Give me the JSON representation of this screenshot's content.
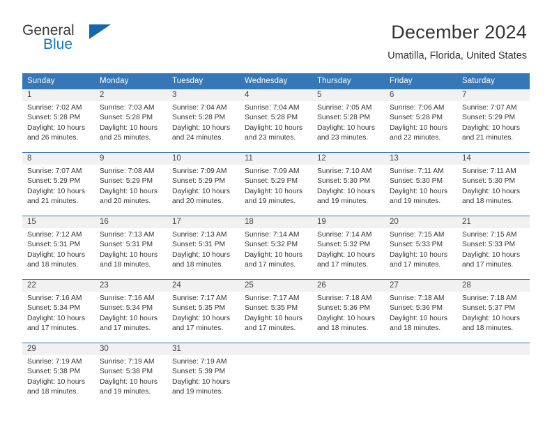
{
  "brand": {
    "name_line1": "General",
    "name_line2": "Blue",
    "triangle_icon": "triangle-icon"
  },
  "header": {
    "title": "December 2024",
    "subtitle": "Umatilla, Florida, United States"
  },
  "colors": {
    "header_blue": "#3577b7",
    "daynum_band": "#f1f1f1",
    "brand_blue": "#1278be",
    "text": "#333333"
  },
  "weekday_headers": [
    "Sunday",
    "Monday",
    "Tuesday",
    "Wednesday",
    "Thursday",
    "Friday",
    "Saturday"
  ],
  "weeks": [
    {
      "days": [
        {
          "num": "1",
          "sunrise": "Sunrise: 7:02 AM",
          "sunset": "Sunset: 5:28 PM",
          "daylight1": "Daylight: 10 hours",
          "daylight2": "and 26 minutes."
        },
        {
          "num": "2",
          "sunrise": "Sunrise: 7:03 AM",
          "sunset": "Sunset: 5:28 PM",
          "daylight1": "Daylight: 10 hours",
          "daylight2": "and 25 minutes."
        },
        {
          "num": "3",
          "sunrise": "Sunrise: 7:04 AM",
          "sunset": "Sunset: 5:28 PM",
          "daylight1": "Daylight: 10 hours",
          "daylight2": "and 24 minutes."
        },
        {
          "num": "4",
          "sunrise": "Sunrise: 7:04 AM",
          "sunset": "Sunset: 5:28 PM",
          "daylight1": "Daylight: 10 hours",
          "daylight2": "and 23 minutes."
        },
        {
          "num": "5",
          "sunrise": "Sunrise: 7:05 AM",
          "sunset": "Sunset: 5:28 PM",
          "daylight1": "Daylight: 10 hours",
          "daylight2": "and 23 minutes."
        },
        {
          "num": "6",
          "sunrise": "Sunrise: 7:06 AM",
          "sunset": "Sunset: 5:28 PM",
          "daylight1": "Daylight: 10 hours",
          "daylight2": "and 22 minutes."
        },
        {
          "num": "7",
          "sunrise": "Sunrise: 7:07 AM",
          "sunset": "Sunset: 5:29 PM",
          "daylight1": "Daylight: 10 hours",
          "daylight2": "and 21 minutes."
        }
      ]
    },
    {
      "days": [
        {
          "num": "8",
          "sunrise": "Sunrise: 7:07 AM",
          "sunset": "Sunset: 5:29 PM",
          "daylight1": "Daylight: 10 hours",
          "daylight2": "and 21 minutes."
        },
        {
          "num": "9",
          "sunrise": "Sunrise: 7:08 AM",
          "sunset": "Sunset: 5:29 PM",
          "daylight1": "Daylight: 10 hours",
          "daylight2": "and 20 minutes."
        },
        {
          "num": "10",
          "sunrise": "Sunrise: 7:09 AM",
          "sunset": "Sunset: 5:29 PM",
          "daylight1": "Daylight: 10 hours",
          "daylight2": "and 20 minutes."
        },
        {
          "num": "11",
          "sunrise": "Sunrise: 7:09 AM",
          "sunset": "Sunset: 5:29 PM",
          "daylight1": "Daylight: 10 hours",
          "daylight2": "and 19 minutes."
        },
        {
          "num": "12",
          "sunrise": "Sunrise: 7:10 AM",
          "sunset": "Sunset: 5:30 PM",
          "daylight1": "Daylight: 10 hours",
          "daylight2": "and 19 minutes."
        },
        {
          "num": "13",
          "sunrise": "Sunrise: 7:11 AM",
          "sunset": "Sunset: 5:30 PM",
          "daylight1": "Daylight: 10 hours",
          "daylight2": "and 19 minutes."
        },
        {
          "num": "14",
          "sunrise": "Sunrise: 7:11 AM",
          "sunset": "Sunset: 5:30 PM",
          "daylight1": "Daylight: 10 hours",
          "daylight2": "and 18 minutes."
        }
      ]
    },
    {
      "days": [
        {
          "num": "15",
          "sunrise": "Sunrise: 7:12 AM",
          "sunset": "Sunset: 5:31 PM",
          "daylight1": "Daylight: 10 hours",
          "daylight2": "and 18 minutes."
        },
        {
          "num": "16",
          "sunrise": "Sunrise: 7:13 AM",
          "sunset": "Sunset: 5:31 PM",
          "daylight1": "Daylight: 10 hours",
          "daylight2": "and 18 minutes."
        },
        {
          "num": "17",
          "sunrise": "Sunrise: 7:13 AM",
          "sunset": "Sunset: 5:31 PM",
          "daylight1": "Daylight: 10 hours",
          "daylight2": "and 18 minutes."
        },
        {
          "num": "18",
          "sunrise": "Sunrise: 7:14 AM",
          "sunset": "Sunset: 5:32 PM",
          "daylight1": "Daylight: 10 hours",
          "daylight2": "and 17 minutes."
        },
        {
          "num": "19",
          "sunrise": "Sunrise: 7:14 AM",
          "sunset": "Sunset: 5:32 PM",
          "daylight1": "Daylight: 10 hours",
          "daylight2": "and 17 minutes."
        },
        {
          "num": "20",
          "sunrise": "Sunrise: 7:15 AM",
          "sunset": "Sunset: 5:33 PM",
          "daylight1": "Daylight: 10 hours",
          "daylight2": "and 17 minutes."
        },
        {
          "num": "21",
          "sunrise": "Sunrise: 7:15 AM",
          "sunset": "Sunset: 5:33 PM",
          "daylight1": "Daylight: 10 hours",
          "daylight2": "and 17 minutes."
        }
      ]
    },
    {
      "days": [
        {
          "num": "22",
          "sunrise": "Sunrise: 7:16 AM",
          "sunset": "Sunset: 5:34 PM",
          "daylight1": "Daylight: 10 hours",
          "daylight2": "and 17 minutes."
        },
        {
          "num": "23",
          "sunrise": "Sunrise: 7:16 AM",
          "sunset": "Sunset: 5:34 PM",
          "daylight1": "Daylight: 10 hours",
          "daylight2": "and 17 minutes."
        },
        {
          "num": "24",
          "sunrise": "Sunrise: 7:17 AM",
          "sunset": "Sunset: 5:35 PM",
          "daylight1": "Daylight: 10 hours",
          "daylight2": "and 17 minutes."
        },
        {
          "num": "25",
          "sunrise": "Sunrise: 7:17 AM",
          "sunset": "Sunset: 5:35 PM",
          "daylight1": "Daylight: 10 hours",
          "daylight2": "and 17 minutes."
        },
        {
          "num": "26",
          "sunrise": "Sunrise: 7:18 AM",
          "sunset": "Sunset: 5:36 PM",
          "daylight1": "Daylight: 10 hours",
          "daylight2": "and 18 minutes."
        },
        {
          "num": "27",
          "sunrise": "Sunrise: 7:18 AM",
          "sunset": "Sunset: 5:36 PM",
          "daylight1": "Daylight: 10 hours",
          "daylight2": "and 18 minutes."
        },
        {
          "num": "28",
          "sunrise": "Sunrise: 7:18 AM",
          "sunset": "Sunset: 5:37 PM",
          "daylight1": "Daylight: 10 hours",
          "daylight2": "and 18 minutes."
        }
      ]
    },
    {
      "days": [
        {
          "num": "29",
          "sunrise": "Sunrise: 7:19 AM",
          "sunset": "Sunset: 5:38 PM",
          "daylight1": "Daylight: 10 hours",
          "daylight2": "and 18 minutes."
        },
        {
          "num": "30",
          "sunrise": "Sunrise: 7:19 AM",
          "sunset": "Sunset: 5:38 PM",
          "daylight1": "Daylight: 10 hours",
          "daylight2": "and 19 minutes."
        },
        {
          "num": "31",
          "sunrise": "Sunrise: 7:19 AM",
          "sunset": "Sunset: 5:39 PM",
          "daylight1": "Daylight: 10 hours",
          "daylight2": "and 19 minutes."
        },
        {
          "num": "",
          "sunrise": "",
          "sunset": "",
          "daylight1": "",
          "daylight2": ""
        },
        {
          "num": "",
          "sunrise": "",
          "sunset": "",
          "daylight1": "",
          "daylight2": ""
        },
        {
          "num": "",
          "sunrise": "",
          "sunset": "",
          "daylight1": "",
          "daylight2": ""
        },
        {
          "num": "",
          "sunrise": "",
          "sunset": "",
          "daylight1": "",
          "daylight2": ""
        }
      ]
    }
  ]
}
